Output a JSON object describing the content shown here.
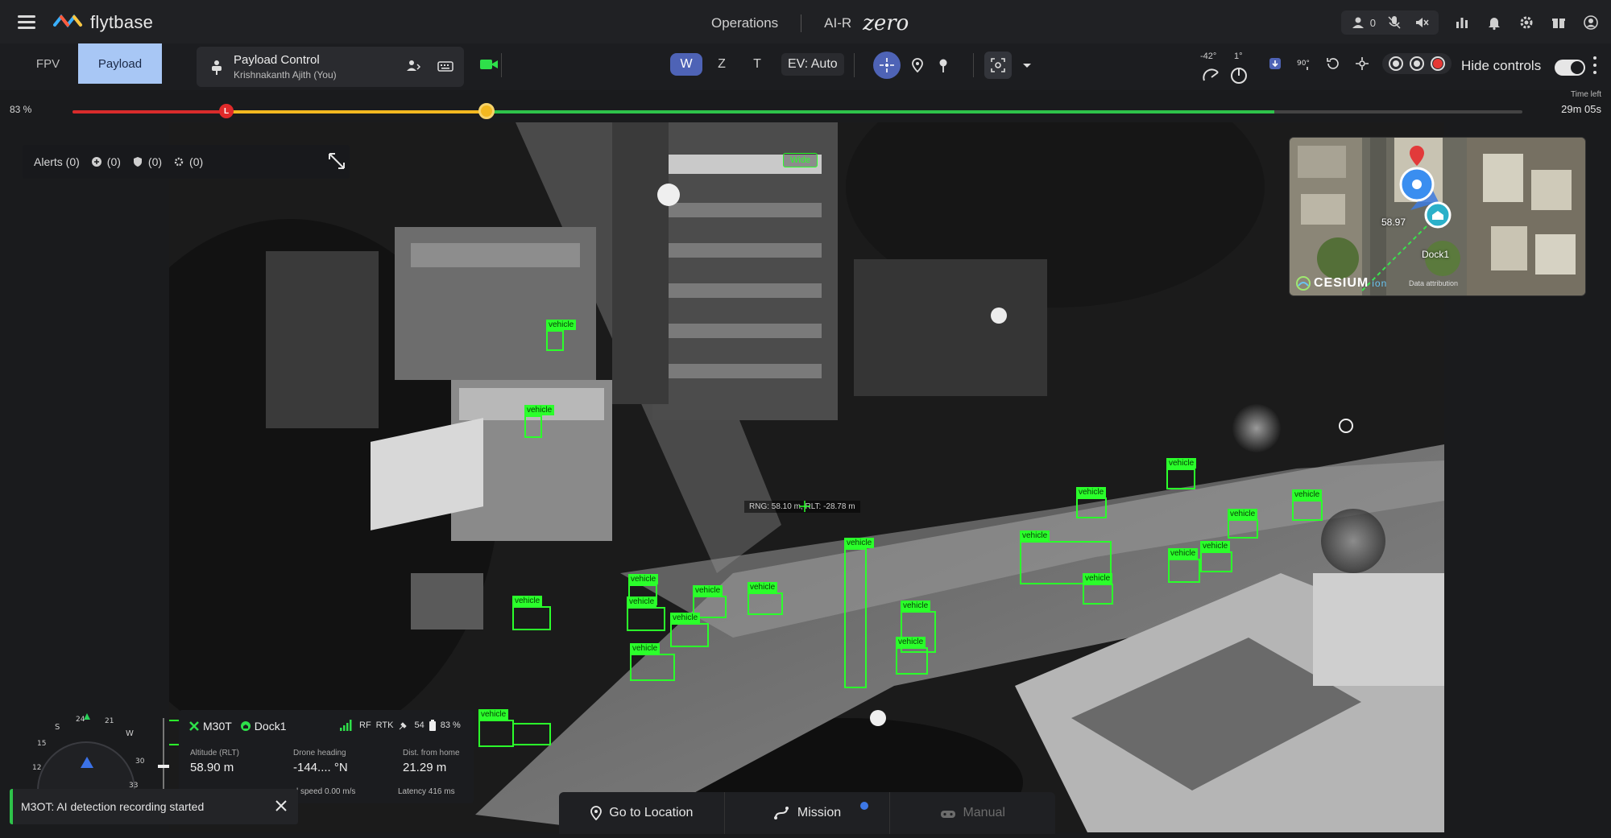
{
  "app": {
    "logo_text": "flytbase",
    "nav": {
      "operations": "Operations",
      "air": "AI-R",
      "zero": "zero"
    },
    "top_right": {
      "user_count": "0"
    }
  },
  "toolbar": {
    "tab_fpv": "FPV",
    "tab_payload": "Payload",
    "payload_control_title": "Payload Control",
    "payload_control_user": "Krishnakanth Ajith (You)",
    "zoom_w": "W",
    "zoom_z": "Z",
    "zoom_t": "T",
    "ev": "EV: Auto",
    "gimbal_pitch": "-42°",
    "gimbal_yaw": "1°",
    "hide_controls": "Hide controls"
  },
  "battery": {
    "percent": "83 %",
    "time_left_label": "Time left",
    "time_left": "29m 05s",
    "marker_label": "L"
  },
  "alerts": {
    "label": "Alerts (0)",
    "c1": "(0)",
    "c2": "(0)",
    "c3": "(0)"
  },
  "feed": {
    "wide_tag": "Wide",
    "range_label": "RNG: 58.10 m, RLT: -28.78 m",
    "detection_label": "vehicle",
    "detections_count": 26
  },
  "minimap": {
    "altitude": "58.97",
    "dock": "Dock1",
    "provider": "CESIUM",
    "provider_suffix": "ion",
    "attribution": "Data attribution"
  },
  "telemetry": {
    "drone": "M30T",
    "dock": "Dock1",
    "link": "RF",
    "rtk": "RTK",
    "satellites": "54",
    "battery": "83 %",
    "altitude_label": "Altitude (RLT)",
    "altitude": "58.90 m",
    "heading_label": "Drone heading",
    "heading": "-144.... °N",
    "dist_label": "Dist. from home",
    "dist": "21.29 m",
    "speed": "l speed 0.00 m/s",
    "latency": "Latency 416 ms",
    "compass": {
      "s": "S",
      "w": "W",
      "n24": "24",
      "n21": "21",
      "n15": "15",
      "n12": "12",
      "n30": "30",
      "n33": "33"
    }
  },
  "toast": {
    "message": "M3OT: AI detection recording started"
  },
  "bottom": {
    "go_to_location": "Go to Location",
    "mission": "Mission",
    "manual": "Manual"
  }
}
